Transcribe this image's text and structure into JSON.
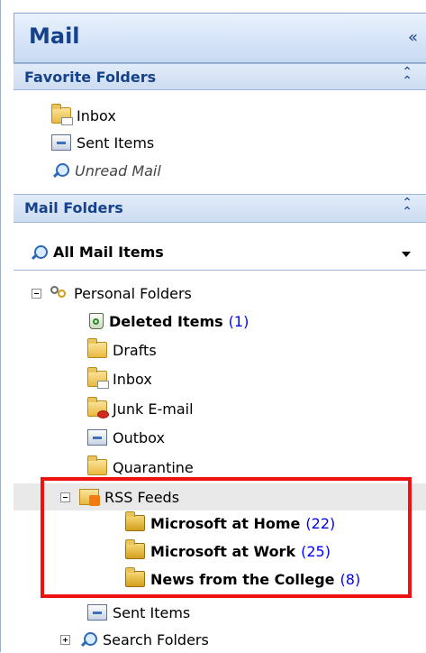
{
  "title": "Mail",
  "collapse_pane_glyph": "«",
  "favorite_folders": {
    "header": "Favorite Folders",
    "chevron": "⌃",
    "items": [
      {
        "label": "Inbox",
        "icon": "inbox-icon"
      },
      {
        "label": "Sent Items",
        "icon": "sent-items-icon"
      },
      {
        "label": "Unread Mail",
        "icon": "search-folder-icon"
      }
    ]
  },
  "mail_folders": {
    "header": "Mail Folders",
    "chevron": "⌃",
    "view_selector": "All Mail Items",
    "root": "Personal Folders",
    "items": [
      {
        "label": "Deleted Items",
        "count": "(1)",
        "icon": "deleted-items-icon"
      },
      {
        "label": "Drafts",
        "icon": "drafts-icon"
      },
      {
        "label": "Inbox",
        "icon": "inbox-icon"
      },
      {
        "label": "Junk E-mail",
        "icon": "junk-mail-icon"
      },
      {
        "label": "Outbox",
        "icon": "outbox-icon"
      },
      {
        "label": "Quarantine",
        "icon": "folder-icon"
      },
      {
        "label": "RSS Feeds",
        "icon": "rss-feed-icon"
      },
      {
        "label": "Microsoft at Home",
        "count": "(22)",
        "icon": "folder-icon"
      },
      {
        "label": "Microsoft at Work",
        "count": "(25)",
        "icon": "folder-icon"
      },
      {
        "label": "News from the College",
        "count": "(8)",
        "icon": "folder-icon"
      },
      {
        "label": "Sent Items",
        "icon": "sent-items-icon"
      },
      {
        "label": "Search Folders",
        "icon": "search-folder-icon"
      }
    ]
  },
  "colors": {
    "header_text": "#15428b",
    "unread_count": "#0000ff",
    "highlight_box": "#ee1111"
  }
}
